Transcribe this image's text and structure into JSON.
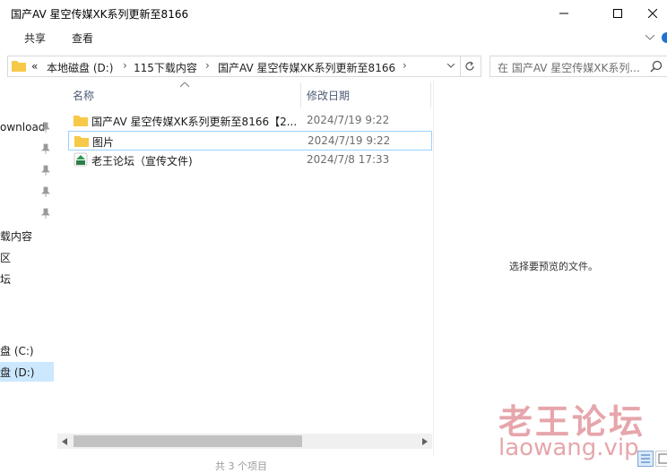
{
  "window": {
    "title": "国产AV 星空传媒XK系列更新至8166"
  },
  "ribbon": {
    "tabs": [
      {
        "label": "共享"
      },
      {
        "label": "查看"
      }
    ]
  },
  "address_bar": {
    "overflow": "«",
    "crumbs": [
      {
        "label": "本地磁盘 (D:)"
      },
      {
        "label": "115下载内容"
      },
      {
        "label": "国产AV 星空传媒XK系列更新至8166"
      }
    ],
    "separator": "›"
  },
  "search": {
    "placeholder": "在 国产AV 星空传媒XK系列..."
  },
  "nav": {
    "items": [
      {
        "label": "ownload",
        "pinned": true
      },
      {
        "label": "",
        "pinned": true
      },
      {
        "label": "",
        "pinned": true
      },
      {
        "label": "",
        "pinned": true
      },
      {
        "label": "",
        "pinned": true
      },
      {
        "label": "载内容",
        "pinned": false
      },
      {
        "label": "区",
        "pinned": false
      },
      {
        "label": "坛",
        "pinned": false
      },
      {
        "label": "盘 (C:)",
        "pinned": false
      },
      {
        "label": "盘 (D:)",
        "pinned": false,
        "selected": true
      }
    ]
  },
  "file_list": {
    "columns": {
      "name": "名称",
      "modified": "修改日期"
    },
    "rows": [
      {
        "name": "国产AV 星空传媒XK系列更新至8166【2...",
        "modified": "2024/7/19 9:22",
        "icon": "folder-icon"
      },
      {
        "name": "图片",
        "modified": "2024/7/19 9:22",
        "icon": "folder-icon"
      },
      {
        "name": "老王论坛（宣传文件)",
        "modified": "2024/7/8 17:33",
        "icon": "shortcut-icon"
      }
    ]
  },
  "preview": {
    "message": "选择要预览的文件。"
  },
  "watermark": {
    "cn": "老王论坛",
    "en": "laowang.vip"
  },
  "status_bar": {
    "text": "共 3 个项目"
  },
  "colors": {
    "folder": "#f7c948",
    "selection_bg": "#cce8ff",
    "focus_border": "#99d1ff",
    "watermark": "#e2969c"
  }
}
